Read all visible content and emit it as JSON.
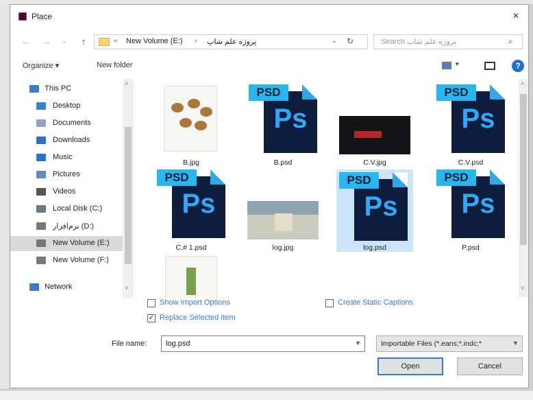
{
  "window": {
    "title": "Place",
    "close": "×"
  },
  "nav": {
    "back": "←",
    "forward": "→",
    "recent": "⌄",
    "up": "↑",
    "address": {
      "overflow": "«",
      "crumb1": "New Volume (E:)",
      "sep": "›",
      "crumb2": "پروژه علم شاپ",
      "dropdown": "⌄",
      "refresh": "↻"
    },
    "search": {
      "placeholder": "Search پروژه علم شاپ",
      "icon": "search-icon"
    }
  },
  "toolbar": {
    "organize": "Organize ▾",
    "new_folder": "New folder",
    "view_dropdown": "▾",
    "help": "?"
  },
  "sidebar": {
    "items": [
      {
        "label": "This PC",
        "icon": "this-pc-icon",
        "color": "#3b7ccc"
      },
      {
        "label": "Desktop",
        "icon": "desktop-icon",
        "color": "#2f86d8"
      },
      {
        "label": "Documents",
        "icon": "documents-icon",
        "color": "#8ca4bf"
      },
      {
        "label": "Downloads",
        "icon": "downloads-icon",
        "color": "#2b6fd0"
      },
      {
        "label": "Music",
        "icon": "music-icon",
        "color": "#2b6fd0"
      },
      {
        "label": "Pictures",
        "icon": "pictures-icon",
        "color": "#5d8bc2"
      },
      {
        "label": "Videos",
        "icon": "videos-icon",
        "color": "#555555"
      },
      {
        "label": "Local Disk (C:)",
        "icon": "drive-icon",
        "color": "#6b7b8c"
      },
      {
        "label": "نرم‌افزار (D:)",
        "icon": "drive-icon",
        "color": "#777777"
      },
      {
        "label": "New Volume (E:)",
        "icon": "drive-icon",
        "color": "#777777"
      },
      {
        "label": "New Volume (F:)",
        "icon": "drive-icon",
        "color": "#777777"
      },
      {
        "label": "Network",
        "icon": "network-icon",
        "color": "#3b7ccc"
      }
    ],
    "selected": "New Volume (E:)"
  },
  "files": [
    {
      "name": "B.jpg",
      "kind": "jpg"
    },
    {
      "name": "B.psd",
      "kind": "psd"
    },
    {
      "name": "C.V.jpg",
      "kind": "jpg"
    },
    {
      "name": "C.V.psd",
      "kind": "psd"
    },
    {
      "name": "C.# 1.psd",
      "kind": "psd"
    },
    {
      "name": "log.jpg",
      "kind": "jpg"
    },
    {
      "name": "log.psd",
      "kind": "psd",
      "selected": true
    },
    {
      "name": "P.psd",
      "kind": "psd"
    },
    {
      "name": "",
      "kind": "jpg"
    }
  ],
  "psd_icon": {
    "tab": "PSD",
    "glyph": "Ps",
    "tab_color": "#27b6f0",
    "body_color": "#0e1d3d"
  },
  "options": {
    "show_import": {
      "label": "Show Import Options",
      "checked": false
    },
    "replace_selected": {
      "label": "Replace Selected Item",
      "checked": true
    },
    "static_captions": {
      "label": "Create Static Captions",
      "checked": false
    }
  },
  "footer": {
    "filename_label": "File name:",
    "filename_value": "log.psd",
    "filetype_value": "Importable Files (*.eans;*.indc;*",
    "open": "Open",
    "cancel": "Cancel"
  },
  "scroll": {
    "up": "˄",
    "down": "˅"
  }
}
